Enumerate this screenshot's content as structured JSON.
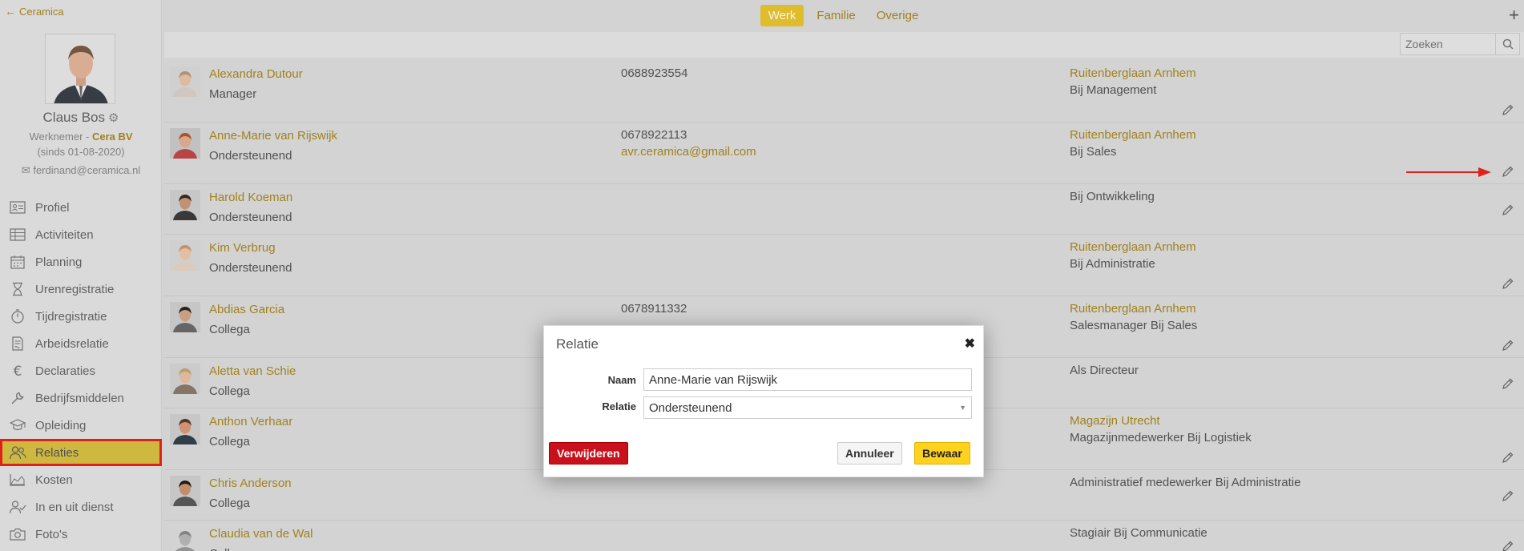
{
  "app": {
    "back_label": "Ceramica"
  },
  "profile": {
    "name": "Claus Bos",
    "role": "Werknemer",
    "role_sep": " - ",
    "company": "Cera BV",
    "since": "(sinds 01-08-2020)",
    "email": "ferdinand@ceramica.nl"
  },
  "nav": [
    {
      "label": "Profiel",
      "icon": "id-card-icon"
    },
    {
      "label": "Activiteiten",
      "icon": "table-icon"
    },
    {
      "label": "Planning",
      "icon": "calendar-icon"
    },
    {
      "label": "Urenregistratie",
      "icon": "hourglass-icon"
    },
    {
      "label": "Tijdregistratie",
      "icon": "stopwatch-icon"
    },
    {
      "label": "Arbeidsrelatie",
      "icon": "contract-icon"
    },
    {
      "label": "Declaraties",
      "icon": "euro-icon"
    },
    {
      "label": "Bedrijfsmiddelen",
      "icon": "wrench-icon"
    },
    {
      "label": "Opleiding",
      "icon": "graduation-cap-icon"
    },
    {
      "label": "Relaties",
      "icon": "users-icon",
      "active": true
    },
    {
      "label": "Kosten",
      "icon": "area-chart-icon"
    },
    {
      "label": "In en uit dienst",
      "icon": "user-check-icon"
    },
    {
      "label": "Foto's",
      "icon": "camera-icon"
    }
  ],
  "tabs": [
    {
      "label": "Werk",
      "active": true
    },
    {
      "label": "Familie"
    },
    {
      "label": "Overige"
    }
  ],
  "search": {
    "placeholder": "Zoeken"
  },
  "relations": [
    {
      "name": "Alexandra Dutour",
      "role": "Manager",
      "phone": "0688923554",
      "email": "",
      "location": "Ruitenberglaan Arnhem",
      "department": "Bij Management"
    },
    {
      "name": "Anne-Marie van Rijswijk",
      "role": "Ondersteunend",
      "phone": "0678922113",
      "email": "avr.ceramica@gmail.com",
      "location": "Ruitenberglaan Arnhem",
      "department": "Bij Sales"
    },
    {
      "name": "Harold Koeman",
      "role": "Ondersteunend",
      "phone": "",
      "email": "",
      "location": "",
      "department": "Bij Ontwikkeling"
    },
    {
      "name": "Kim Verbrug",
      "role": "Ondersteunend",
      "phone": "",
      "email": "",
      "location": "Ruitenberglaan Arnhem",
      "department": "Bij Administratie"
    },
    {
      "name": "Abdias Garcia",
      "role": "Collega",
      "phone": "0678911332",
      "email": "",
      "location": "Ruitenberglaan Arnhem",
      "department": "Salesmanager Bij Sales"
    },
    {
      "name": "Aletta van Schie",
      "role": "Collega",
      "phone": "",
      "email": "",
      "location": "",
      "department": "Als Directeur"
    },
    {
      "name": "Anthon Verhaar",
      "role": "Collega",
      "phone": "",
      "email": "",
      "location": "Magazijn Utrecht",
      "department": "Magazijnmedewerker Bij Logistiek"
    },
    {
      "name": "Chris Anderson",
      "role": "Collega",
      "phone": "",
      "email": "",
      "location": "",
      "department": "Administratief medewerker Bij Administratie"
    },
    {
      "name": "Claudia van de Wal",
      "role": "Collega",
      "phone": "",
      "email": "",
      "location": "",
      "department": "Stagiair Bij Communicatie"
    }
  ],
  "modal": {
    "title": "Relatie",
    "name_label": "Naam",
    "name_value": "Anne-Marie van Rijswijk",
    "relation_label": "Relatie",
    "relation_value": "Ondersteunend",
    "delete_label": "Verwijderen",
    "cancel_label": "Annuleer",
    "save_label": "Bewaar"
  },
  "colors": {
    "accent": "#a8871e",
    "tab_active": "#e8c42e",
    "nav_active": "#d8c043",
    "highlight": "#e8231b",
    "delete": "#c8111c",
    "save": "#ffd21f"
  }
}
